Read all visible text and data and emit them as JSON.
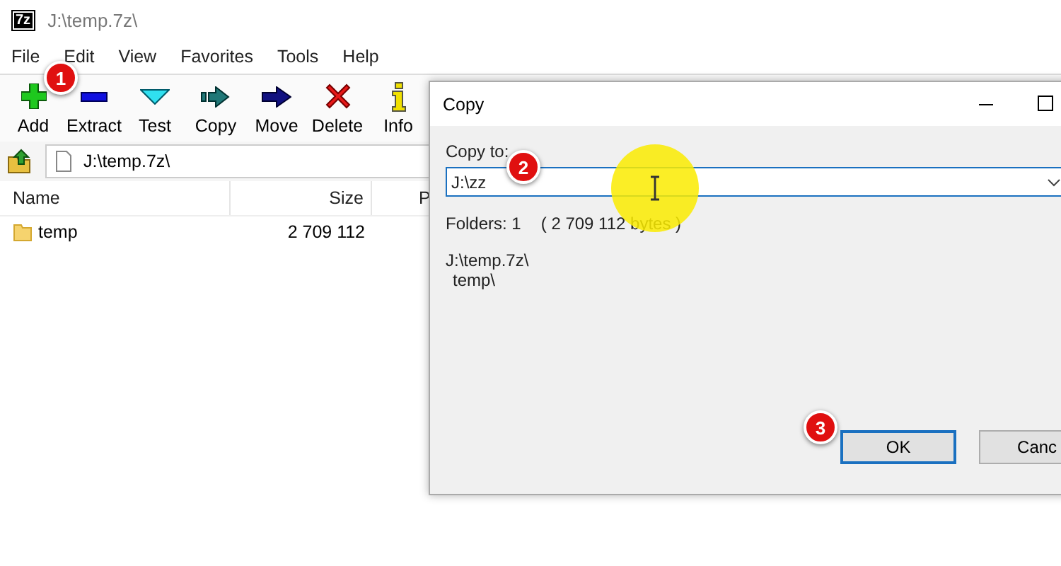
{
  "window": {
    "app_icon": "7z",
    "title": "J:\\temp.7z\\"
  },
  "menu": [
    "File",
    "Edit",
    "View",
    "Favorites",
    "Tools",
    "Help"
  ],
  "toolbar": [
    {
      "label": "Add",
      "kind": "add"
    },
    {
      "label": "Extract",
      "kind": "extract"
    },
    {
      "label": "Test",
      "kind": "test"
    },
    {
      "label": "Copy",
      "kind": "copy"
    },
    {
      "label": "Move",
      "kind": "move"
    },
    {
      "label": "Delete",
      "kind": "delete"
    },
    {
      "label": "Info",
      "kind": "info"
    }
  ],
  "address": "J:\\temp.7z\\",
  "columns": [
    "Name",
    "Size",
    "P"
  ],
  "rows": [
    {
      "name": "temp",
      "size": "2 709 112",
      "kind": "folder"
    }
  ],
  "dialog": {
    "title": "Copy",
    "label": "Copy to:",
    "value": "J:\\zz",
    "folders": "Folders: 1",
    "bytes": "( 2 709 112 bytes )",
    "paths": [
      "J:\\temp.7z\\",
      "temp\\"
    ],
    "buttons": [
      {
        "label": "OK",
        "focused": true
      },
      {
        "label": "Canc",
        "focused": false
      }
    ]
  },
  "callouts": [
    "1",
    "2",
    "3"
  ]
}
